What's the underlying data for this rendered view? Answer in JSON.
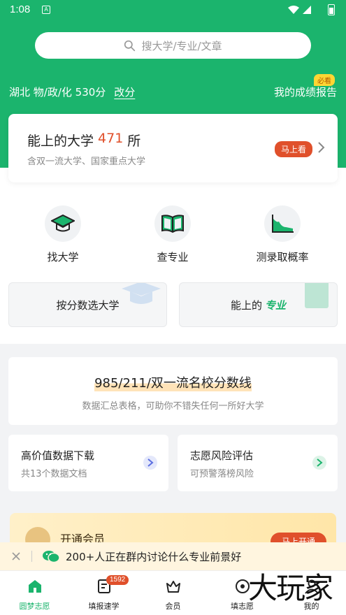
{
  "status_bar": {
    "time": "1:08",
    "notification_icon": "A"
  },
  "search": {
    "placeholder": "搜大学/专业/文章"
  },
  "user_info": {
    "profile": "湖北 物/政/化 530分",
    "change_label": "改分"
  },
  "report": {
    "label": "我的成绩报告",
    "badge": "必看"
  },
  "uni_card": {
    "title_prefix": "能上的大学",
    "count": "471",
    "title_suffix": "所",
    "subtitle": "含双一流大学、国家重点大学",
    "button": "马上看"
  },
  "features": [
    {
      "label": "找大学",
      "icon": "graduation-cap-icon"
    },
    {
      "label": "查专业",
      "icon": "open-book-icon"
    },
    {
      "label": "测录取概率",
      "icon": "area-chart-icon"
    }
  ],
  "quick_links": [
    {
      "label": "按分数选大学"
    },
    {
      "label": "能上的",
      "tag": "专业"
    }
  ],
  "score_card": {
    "title": "985/211/双一流名校分数线",
    "subtitle": "数据汇总表格，可助你不错失任何一所好大学"
  },
  "small_cards": [
    {
      "title": "高价值数据下载",
      "subtitle": "共13个数据文档",
      "accent": "#5b6ee1"
    },
    {
      "title": "志愿风险评估",
      "subtitle": "可预警落榜风险",
      "accent": "#1bb46d"
    }
  ],
  "vip": {
    "title": "开通会员",
    "button": "马上开通"
  },
  "notice": {
    "text": "200+人正在群内讨论什么专业前景好"
  },
  "tabbar": {
    "tabs": [
      {
        "label": "圆梦志愿",
        "icon": "home-icon",
        "active": true
      },
      {
        "label": "填报速学",
        "icon": "document-icon",
        "badge": "1592"
      },
      {
        "label": "会员",
        "icon": "crown-icon"
      },
      {
        "label": "填志愿",
        "icon": "target-icon"
      },
      {
        "label": "我的",
        "icon": "user-icon"
      }
    ]
  },
  "watermark": "大玩家",
  "colors": {
    "brand_green": "#1bb46d",
    "accent_red": "#e0502b"
  }
}
